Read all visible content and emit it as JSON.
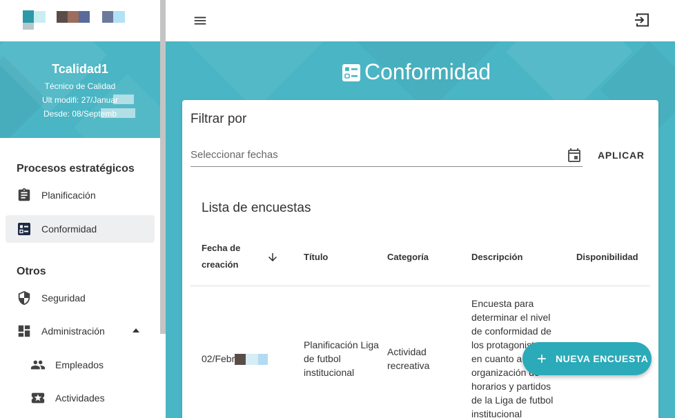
{
  "sidebar": {
    "user": {
      "name": "Tcalidad1",
      "role": "Técnico de Calidad",
      "last_modified": "Ult modifi: 27/Januar",
      "since": "Desde: 08/Septemb"
    },
    "sections": [
      {
        "label": "Procesos estratégicos"
      },
      {
        "label": "Otros"
      }
    ],
    "items": [
      {
        "label": "Planificación",
        "icon": "clipboard-icon"
      },
      {
        "label": "Conformidad",
        "icon": "checklist-icon",
        "active": true
      },
      {
        "label": "Seguridad",
        "icon": "shield-icon"
      },
      {
        "label": "Administración",
        "icon": "dashboard-icon"
      },
      {
        "label": "Empleados",
        "icon": "people-icon"
      },
      {
        "label": "Actividades",
        "icon": "ticket-star-icon"
      }
    ]
  },
  "page": {
    "title": "Conformidad",
    "filter_title": "Filtrar por",
    "date_placeholder": "Seleccionar fechas",
    "apply_label": "APLICAR",
    "list_title": "Lista de encuestas",
    "columns": {
      "date": "Fecha de creación",
      "title": "Título",
      "category": "Categoría",
      "description": "Descripción",
      "availability": "Disponibilidad"
    },
    "rows": [
      {
        "date": "02/Febr",
        "title": "Planificación Liga de futbol institucional",
        "category": "Actividad recreativa",
        "description": "Encuesta para determinar el nivel de conformidad de los protagonistas en cuanto a organización de horarios y partidos de la Liga de futbol institucional"
      }
    ],
    "fab_label": "NUEVA ENCUESTA"
  },
  "colors": {
    "accent": "#4ab5c4",
    "fab": "#2baab9",
    "active_bg": "#eeeff1"
  }
}
